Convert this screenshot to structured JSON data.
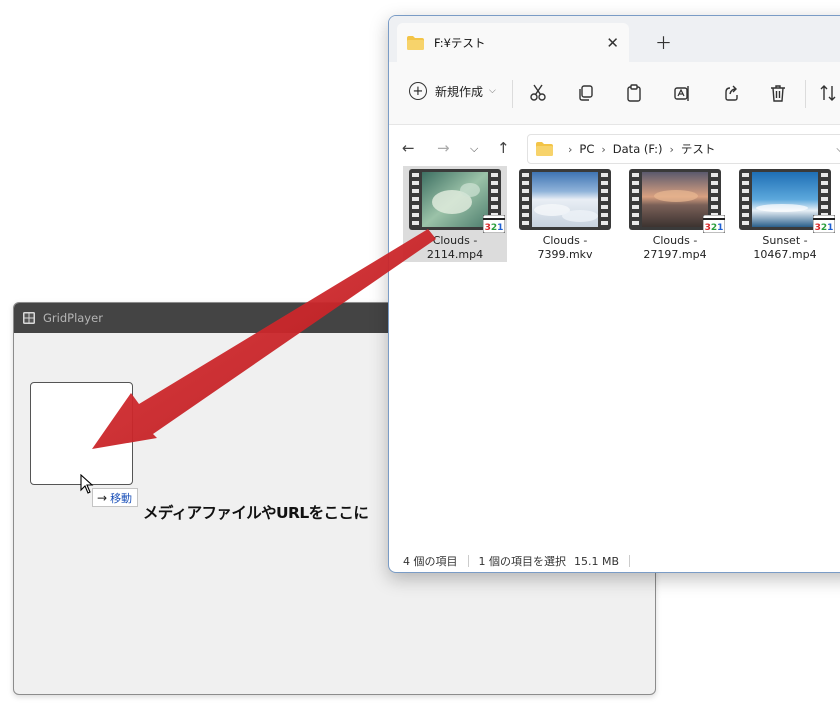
{
  "gridplayer": {
    "title": "GridPlayer",
    "drop_message": "メディアファイルやURLをここに"
  },
  "drag_tooltip": {
    "label": "移動"
  },
  "explorer": {
    "tab_title": "F:¥テスト",
    "toolbar": {
      "new_label": "新規作成"
    },
    "breadcrumb": [
      "PC",
      "Data (F:)",
      "テスト"
    ],
    "files": [
      {
        "name_line1": "Clouds -",
        "name_line2": "2114.mp4",
        "selected": true
      },
      {
        "name_line1": "Clouds -",
        "name_line2": "7399.mkv",
        "selected": false
      },
      {
        "name_line1": "Clouds -",
        "name_line2": "27197.mp4",
        "selected": false
      },
      {
        "name_line1": "Sunset -",
        "name_line2": "10467.mp4",
        "selected": false
      }
    ],
    "status": {
      "item_count": "4 個の項目",
      "selection": "1 個の項目を選択",
      "size": "15.1 MB"
    }
  },
  "colors": {
    "arrow": "#cc1f24",
    "folder": "#f3c447",
    "address_accent": "#0067c0"
  }
}
